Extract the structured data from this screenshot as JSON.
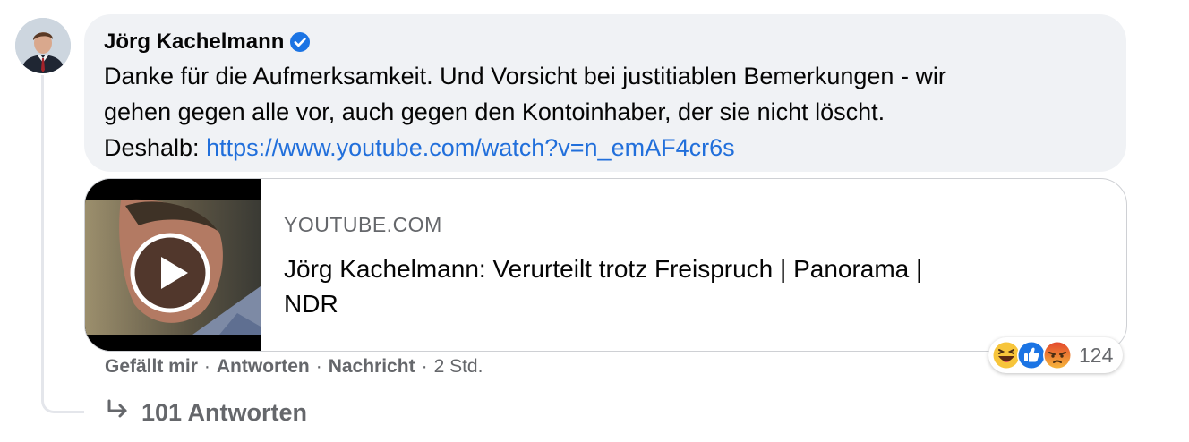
{
  "comment": {
    "author": "Jörg Kachelmann",
    "verified_icon": "verified-badge-icon",
    "text_line1": "Danke für die Aufmerksamkeit. Und Vorsicht bei justitiablen Bemerkungen - wir",
    "text_line2": "gehen gegen alle vor, auch gegen den Kontoinhaber, der sie nicht löscht.",
    "text_prefix": "Deshalb: ",
    "link": "https://www.youtube.com/watch?v=n_emAF4cr6s"
  },
  "link_preview": {
    "domain": "YOUTUBE.COM",
    "title_line1": "Jörg Kachelmann: Verurteilt trotz Freispruch | Panorama |",
    "title_line2": "NDR",
    "play_icon": "play-icon"
  },
  "actions": {
    "like": "Gefällt mir",
    "reply": "Antworten",
    "message": "Nachricht",
    "separator": "·",
    "time": "2 Std."
  },
  "reactions": {
    "icons": [
      "haha-icon",
      "like-icon",
      "angry-icon"
    ],
    "count": "124"
  },
  "replies": {
    "label": "101 Antworten",
    "icon": "reply-arrow-icon"
  },
  "colors": {
    "link": "#216fdb",
    "bubble_bg": "#f0f2f5",
    "secondary_text": "#65676b",
    "verified": "#1b74e4"
  }
}
